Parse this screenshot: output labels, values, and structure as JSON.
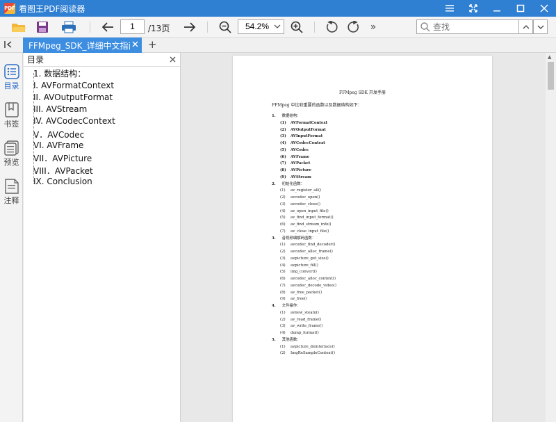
{
  "window": {
    "app_title": "看图王PDF阅读器",
    "logo_text": "PDF"
  },
  "toolbar": {
    "page_current": "1",
    "page_total": "/13页",
    "zoom": "54.2%",
    "search_placeholder": "查找"
  },
  "tabs": [
    {
      "label": "FFMpeg_SDK_详细中文指南（"
    }
  ],
  "rail": [
    {
      "label": "目录"
    },
    {
      "label": "书签"
    },
    {
      "label": "预览"
    },
    {
      "label": "注释"
    }
  ],
  "toc": {
    "title": "目录",
    "items": [
      "1. 数据结构：",
      "I. AVFormatContext",
      "II. AVOutputFormat",
      "III. AVStream",
      "IV. AVCodecContext",
      "V．AVCodec",
      "VI. AVFrame",
      "VII．AVPicture",
      "VIII．AVPacket",
      "IX. Conclusion"
    ]
  },
  "document": {
    "title": "FFMpeg SDK 开发手册",
    "intro": "FFMpeg 中比较重要的函数以及数据结构如下：",
    "sections": [
      {
        "num": "1.",
        "title": "数据结构：",
        "bold_items": true,
        "items": [
          "AVFormatContext",
          "AVOutputFormat",
          "AVInputFormat",
          "AVCodecContext",
          "AVCodec",
          "AVFrame",
          "AVPacket",
          "AVPicture",
          "AVStream"
        ]
      },
      {
        "num": "2.",
        "title": "初始化函数：",
        "bold_items": false,
        "items": [
          "av_register_all()",
          "avcodec_open()",
          "avcodec_close()",
          "av_open_input_file()",
          "av_find_input_format()",
          "av_find_stream_info()",
          "av_close_input_file()"
        ]
      },
      {
        "num": "3.",
        "title": "音视频编解码函数：",
        "bold_items": false,
        "items": [
          "avcodec_find_decoder()",
          "avcodec_alloc_frame()",
          "avpicture_get_size()",
          "avpicture_fill()",
          "img_convert()",
          "avcodec_alloc_context()",
          "avcodec_decode_video()",
          "av_free_packet()",
          "av_free()"
        ]
      },
      {
        "num": "4.",
        "title": "文件操作：",
        "bold_items": false,
        "items": [
          "avnew_steam()",
          "av_read_frame()",
          "av_write_frame()",
          "dump_format()"
        ]
      },
      {
        "num": "5.",
        "title": "其他函数：",
        "bold_items": false,
        "items": [
          "avpicture_deinterlace()",
          "ImgReSampleContext()"
        ]
      }
    ]
  }
}
